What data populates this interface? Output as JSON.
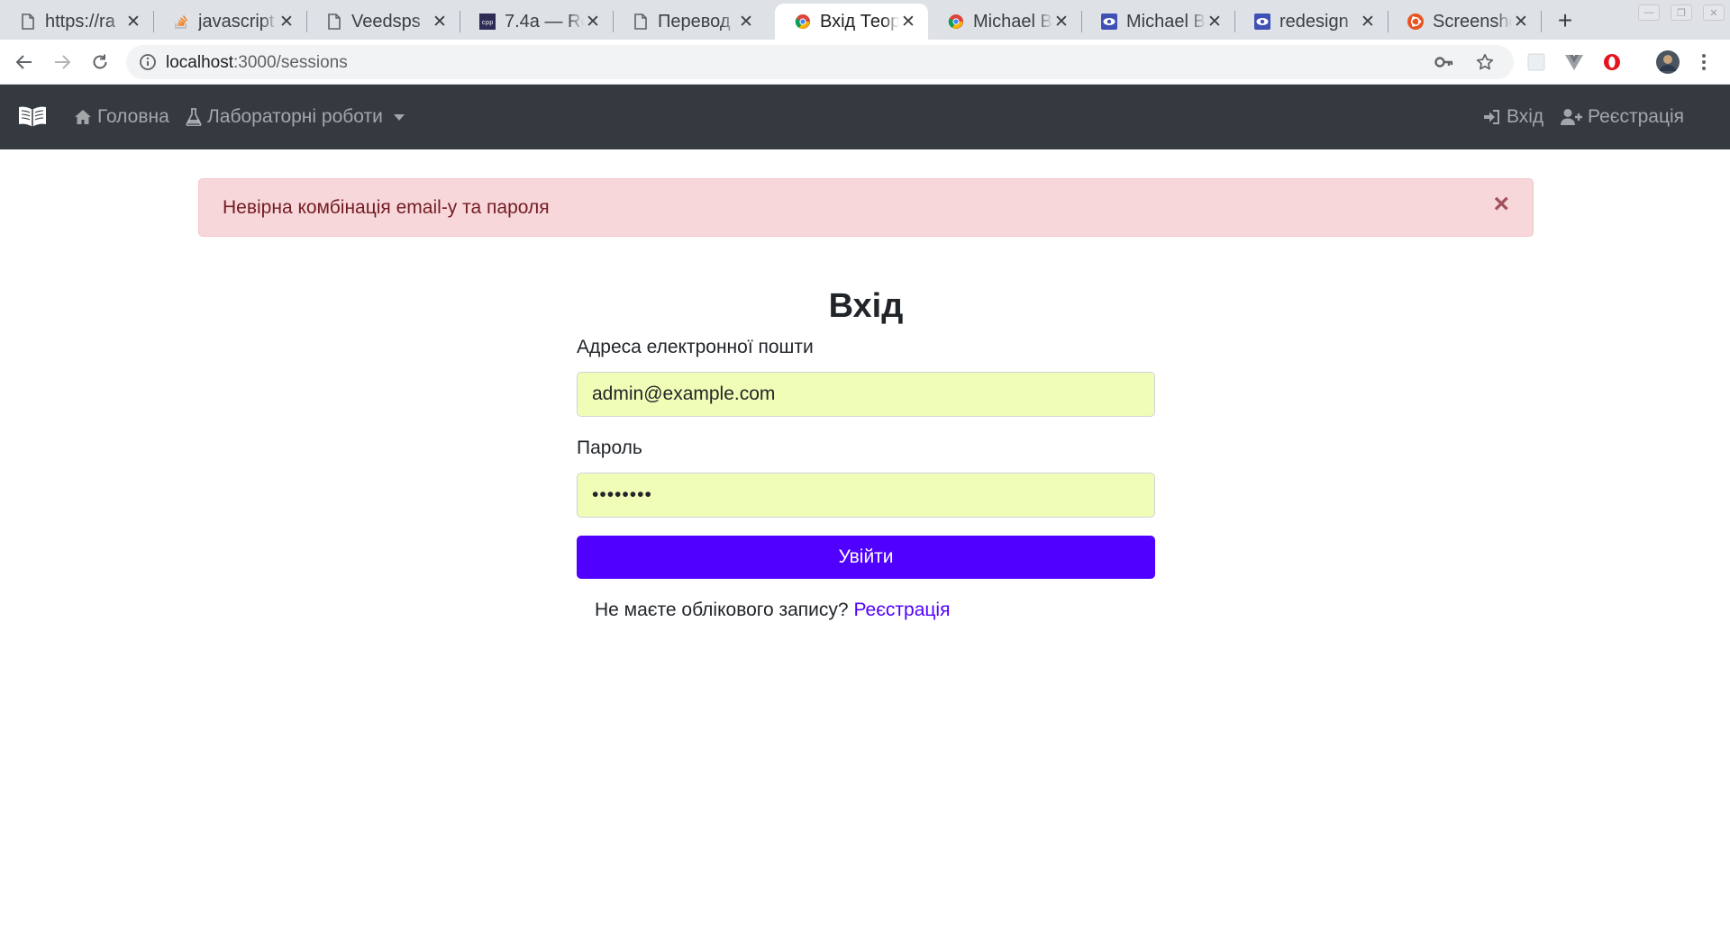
{
  "browser": {
    "tabs": [
      {
        "title": "https://ra",
        "icon": "page-icon",
        "active": false
      },
      {
        "title": "javascript",
        "icon": "stackoverflow-icon",
        "active": false
      },
      {
        "title": "Veedsps",
        "icon": "page-icon",
        "active": false
      },
      {
        "title": "7.4a — Re",
        "icon": "cpp-icon",
        "active": false
      },
      {
        "title": "Перевод",
        "icon": "page-icon",
        "active": false
      },
      {
        "title": "Вхід Теор",
        "icon": "chrome-icon",
        "active": true
      },
      {
        "title": "Michael B",
        "icon": "chrome-icon",
        "active": false
      },
      {
        "title": "Michael B",
        "icon": "eye-icon",
        "active": false
      },
      {
        "title": "redesign",
        "icon": "eye-icon",
        "active": false
      },
      {
        "title": "Screensho",
        "icon": "ubuntu-icon",
        "active": false
      }
    ],
    "close_glyph": "✕",
    "new_tab_glyph": "+",
    "url_host": "localhost",
    "url_path": ":3000/sessions"
  },
  "navbar": {
    "home_label": "Головна",
    "labs_label": "Лабораторні роботи",
    "login_label": "Вхід",
    "register_label": "Реєстрація"
  },
  "alert": {
    "message": "Невірна комбінація email-у та пароля",
    "close": "×"
  },
  "form": {
    "title": "Вхід",
    "email_label": "Адреса електронної пошти",
    "email_value": "admin@example.com",
    "password_label": "Пароль",
    "password_value": "••••••••",
    "submit_label": "Увійти",
    "no_account_text": "Не маєте облікового запису? ",
    "register_link": "Реєстрація"
  },
  "colors": {
    "navbar_bg": "#343a40",
    "alert_bg": "#f8d7da",
    "alert_text": "#721c24",
    "autofill_bg": "#f0fdb7",
    "primary": "#5000ff"
  }
}
